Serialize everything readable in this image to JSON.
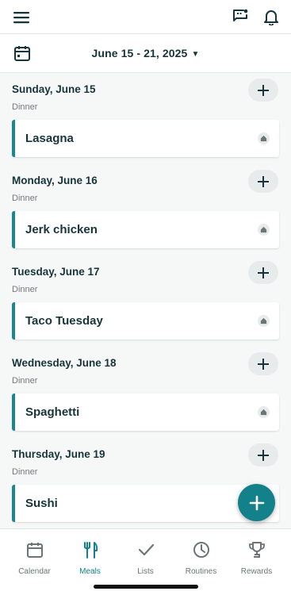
{
  "header": {
    "menu_icon": "hamburger-menu-icon",
    "actions": [
      "message-alert-icon",
      "bell-icon"
    ]
  },
  "week": {
    "calendar_icon": "calendar-icon",
    "range": "June 15 - 21, 2025",
    "caret_icon": "caret-down-icon"
  },
  "days": [
    {
      "title": "Sunday, June 15",
      "meal_type": "Dinner",
      "meal": "Lasagna"
    },
    {
      "title": "Monday, June 16",
      "meal_type": "Dinner",
      "meal": "Jerk chicken"
    },
    {
      "title": "Tuesday, June 17",
      "meal_type": "Dinner",
      "meal": "Taco Tuesday"
    },
    {
      "title": "Wednesday, June 18",
      "meal_type": "Dinner",
      "meal": "Spaghetti"
    },
    {
      "title": "Thursday, June 19",
      "meal_type": "Dinner",
      "meal": "Sushi"
    }
  ],
  "fab": {
    "icon": "plus-icon"
  },
  "tabs": [
    {
      "label": "Calendar",
      "icon": "calendar-icon",
      "active": false
    },
    {
      "label": "Meals",
      "icon": "fork-knife-icon",
      "active": true
    },
    {
      "label": "Lists",
      "icon": "checkmark-icon",
      "active": false
    },
    {
      "label": "Routines",
      "icon": "clock-icon",
      "active": false
    },
    {
      "label": "Rewards",
      "icon": "trophy-icon",
      "active": false
    }
  ],
  "colors": {
    "accent": "#138189",
    "text": "#17343b",
    "muted": "#747a7c",
    "background": "#f6f7f7"
  }
}
